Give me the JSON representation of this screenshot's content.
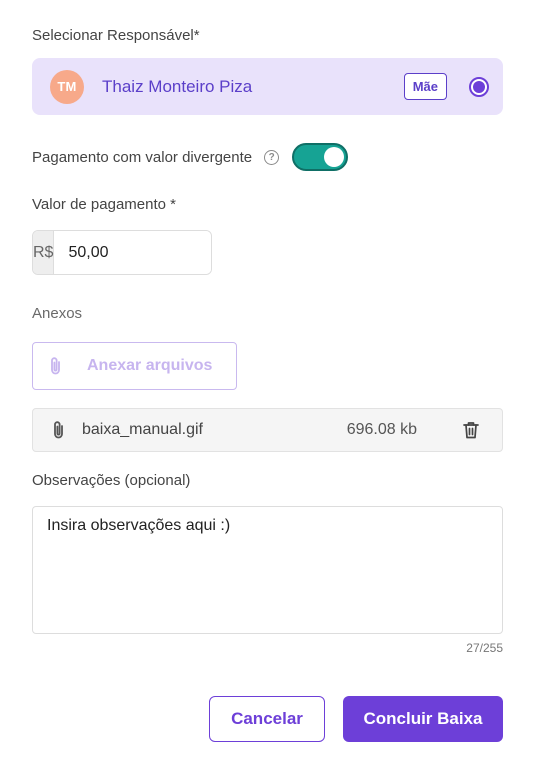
{
  "responsible": {
    "label": "Selecionar Responsável*",
    "avatar_initials": "TM",
    "name": "Thaiz Monteiro Piza",
    "relation_tag": "Mãe",
    "selected": true
  },
  "divergent_payment": {
    "label": "Pagamento com valor divergente",
    "help_icon": "question-circle-icon",
    "enabled": true
  },
  "payment_value": {
    "label": "Valor de pagamento *",
    "currency_prefix": "R$",
    "value": "50,00"
  },
  "attachments": {
    "label": "Anexos",
    "attach_button_label": "Anexar arquivos",
    "files": [
      {
        "name": "baixa_manual.gif",
        "size": "696.08 kb"
      }
    ]
  },
  "notes": {
    "label": "Observações (opcional)",
    "value": "Insira observações aqui :)",
    "counter": "27/255"
  },
  "actions": {
    "cancel_label": "Cancelar",
    "confirm_label": "Concluir Baixa"
  },
  "colors": {
    "primary": "#6d3fd8",
    "card_background": "#e9e2fb",
    "toggle_on": "#16a394",
    "avatar": "#f7a98a"
  }
}
